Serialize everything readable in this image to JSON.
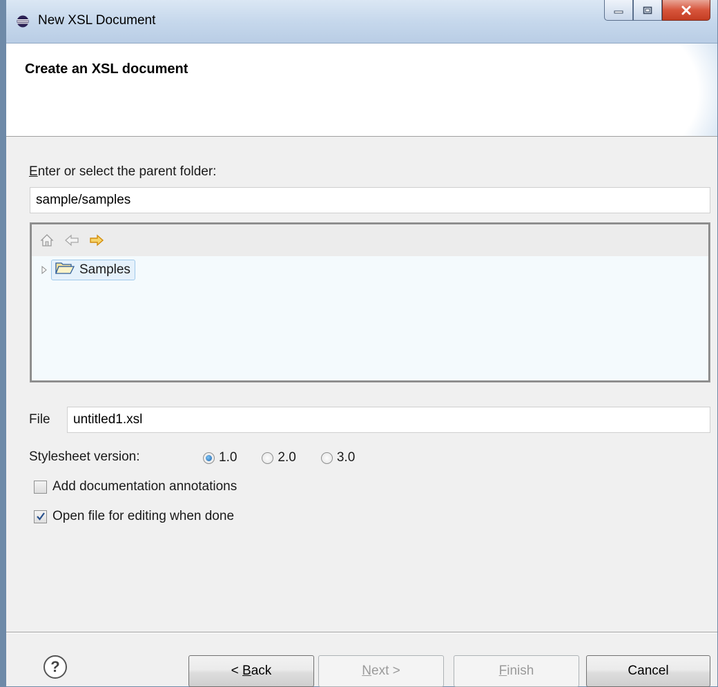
{
  "window": {
    "title": "New XSL Document",
    "icon": "eclipse-icon",
    "controls": [
      "minimize-icon",
      "maximize-icon",
      "close-icon"
    ]
  },
  "banner": {
    "heading": "Create an XSL document"
  },
  "parent_folder": {
    "label_first": "E",
    "label_rest": "nter or select the parent folder:",
    "value": "sample/samples"
  },
  "tree": {
    "toolbar": [
      "home-icon",
      "back-arrow-icon",
      "forward-arrow-icon"
    ],
    "items": [
      {
        "label": "Samples",
        "icon": "open-folder-icon",
        "expanded": false,
        "selected": true
      }
    ]
  },
  "file": {
    "label": "File",
    "value": "untitled1.xsl"
  },
  "stylesheet": {
    "label": "Stylesheet version:",
    "options": [
      {
        "label": "1.0",
        "selected": true
      },
      {
        "label": "2.0",
        "selected": false
      },
      {
        "label": "3.0",
        "selected": false
      }
    ]
  },
  "options": {
    "add_docs": {
      "label": "Add documentation annotations",
      "checked": false
    },
    "open_file": {
      "label": "Open file for editing when done",
      "checked": true
    }
  },
  "buttons": {
    "back": {
      "prefix": "< ",
      "mnemonic": "B",
      "rest": "ack"
    },
    "next": {
      "mnemonic": "N",
      "rest": "ext >"
    },
    "finish": {
      "mnemonic": "F",
      "rest": "inish"
    },
    "cancel": "Cancel"
  },
  "colors": {
    "accent": "#1b5fa8",
    "forward_arrow": "#e8a317",
    "tree_selection": "#e5f1fb"
  }
}
